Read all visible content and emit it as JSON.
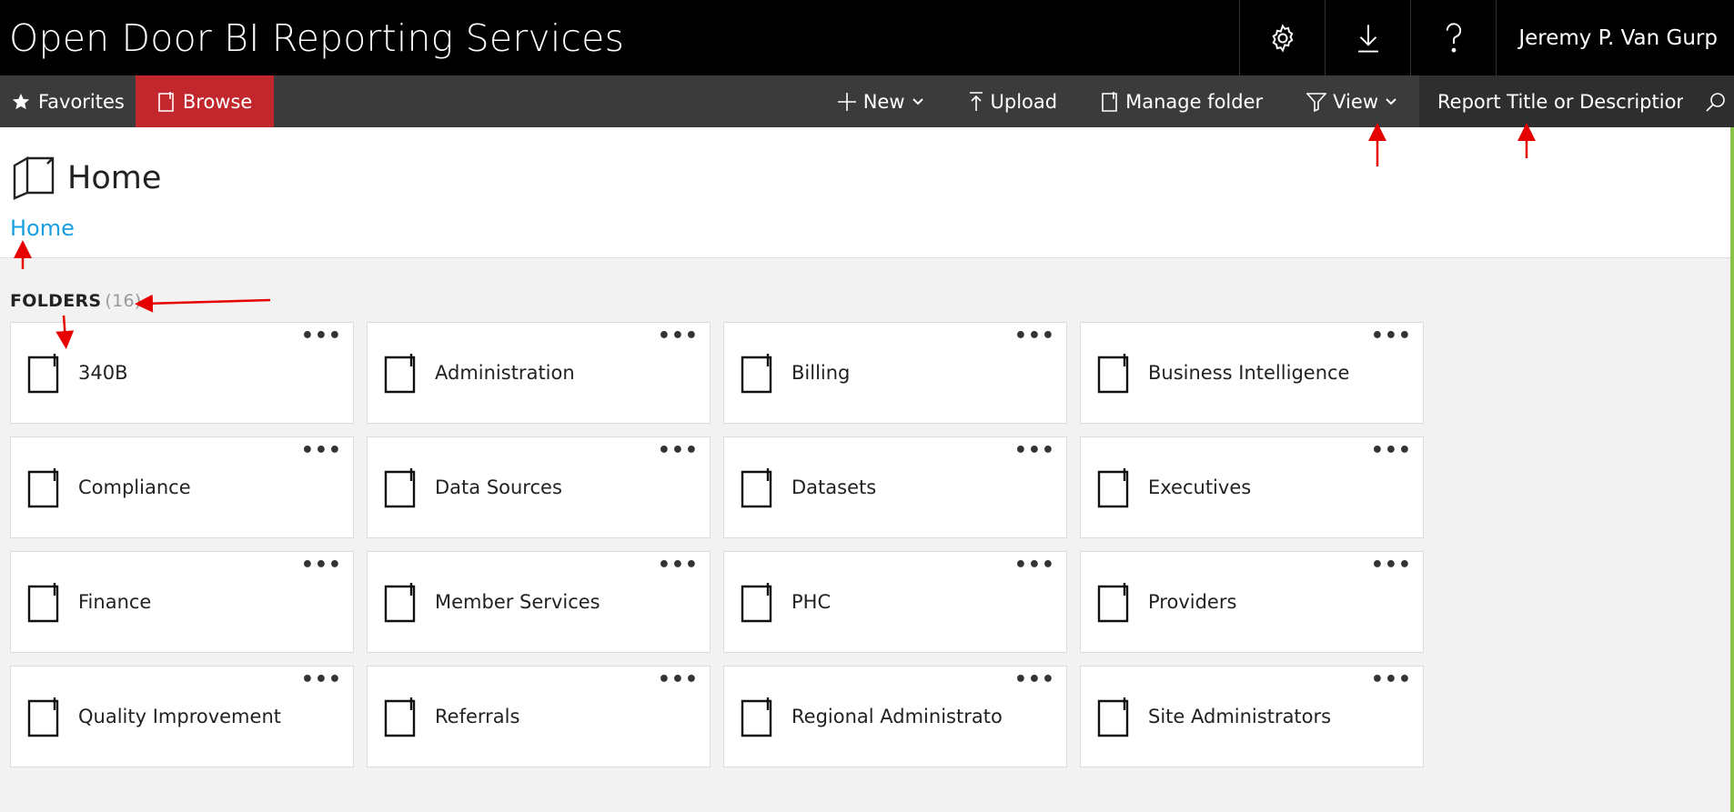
{
  "app": {
    "title": "Open Door BI Reporting Services"
  },
  "topbar": {
    "user_name": "Jeremy P. Van Gurp",
    "icons": [
      "gear-icon",
      "download-icon",
      "help-icon"
    ]
  },
  "nav": {
    "favorites_label": "Favorites",
    "browse_label": "Browse",
    "new_label": "New",
    "upload_label": "Upload",
    "manage_folder_label": "Manage folder",
    "view_label": "View",
    "search_placeholder": "Report Title or Description"
  },
  "page": {
    "title": "Home",
    "breadcrumb": "Home"
  },
  "folders": {
    "heading": "FOLDERS",
    "count": "(16)",
    "more_label": "•••",
    "items": [
      {
        "label": "340B"
      },
      {
        "label": "Administration"
      },
      {
        "label": "Billing"
      },
      {
        "label": "Business Intelligence"
      },
      {
        "label": "Compliance"
      },
      {
        "label": "Data Sources"
      },
      {
        "label": "Datasets"
      },
      {
        "label": "Executives"
      },
      {
        "label": "Finance"
      },
      {
        "label": "Member Services"
      },
      {
        "label": "PHC"
      },
      {
        "label": "Providers"
      },
      {
        "label": "Quality Improvement"
      },
      {
        "label": "Referrals"
      },
      {
        "label": "Regional Administrators"
      },
      {
        "label": "Site Administrators"
      }
    ]
  },
  "colors": {
    "accent": "#c1272d",
    "link": "#1aa0e0",
    "annotation": "#e60000",
    "edge": "#8ac24a"
  }
}
